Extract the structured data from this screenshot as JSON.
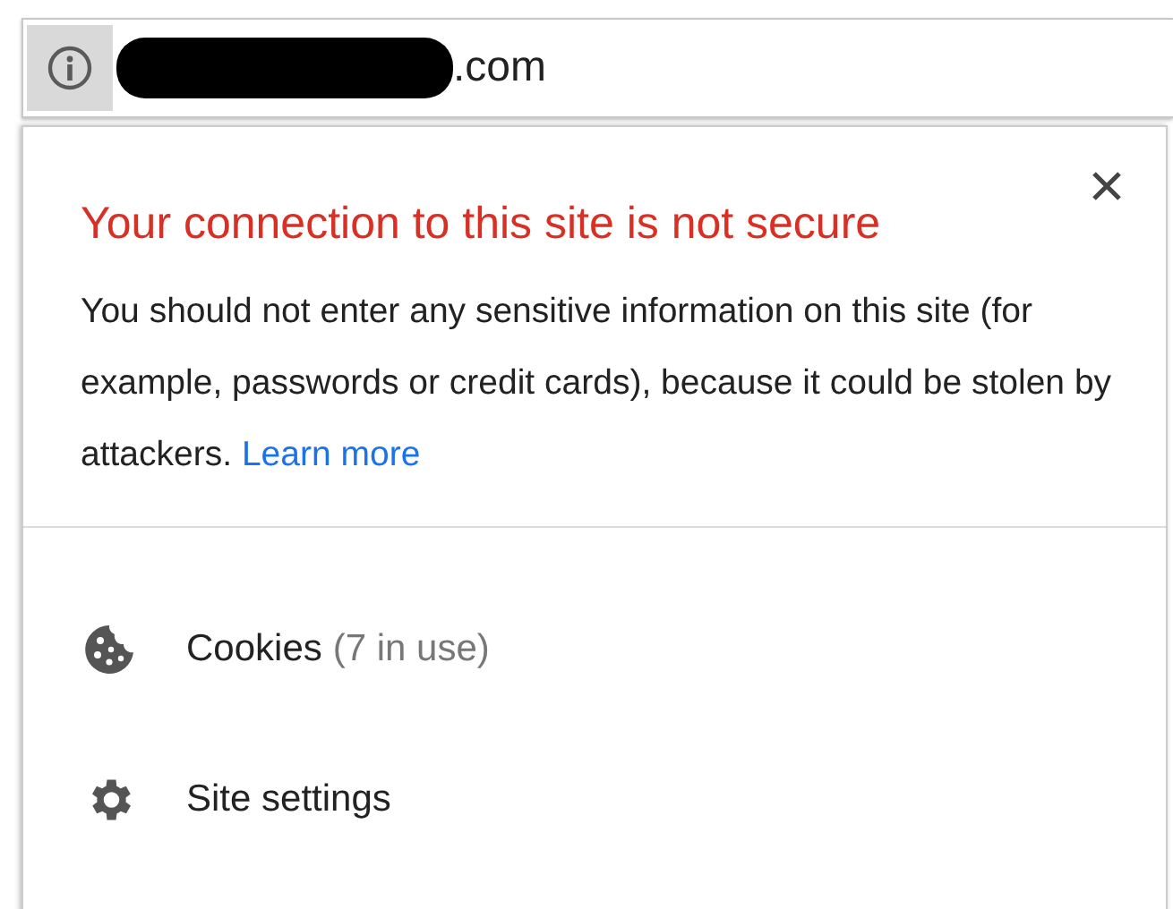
{
  "address_bar": {
    "domain_suffix": ".com"
  },
  "popup": {
    "title": "Your connection to this site is not secure",
    "message": "You should not enter any sensitive information on this site (for example, passwords or credit cards), because it could be stolen by attackers.",
    "link": "Learn more"
  },
  "items": [
    {
      "kind": "cookies",
      "label": "Cookies",
      "detail": "(7 in use)"
    },
    {
      "kind": "settings",
      "label": "Site settings"
    }
  ]
}
